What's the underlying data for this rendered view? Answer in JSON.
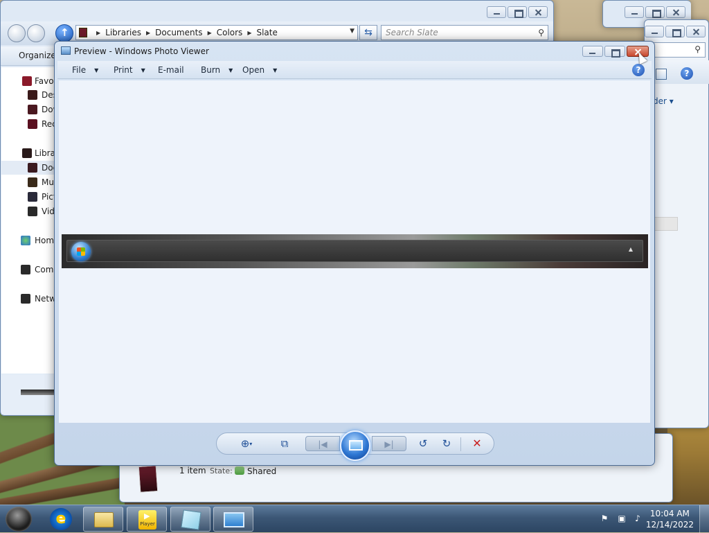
{
  "explorer": {
    "breadcrumb": [
      "Libraries",
      "Documents",
      "Colors",
      "Slate"
    ],
    "search_placeholder": "Search Slate",
    "organize_label": "Organize",
    "nav_items": [
      {
        "label": "Favorites",
        "group": "favorites"
      },
      {
        "label": "Desktop",
        "group": "favorites"
      },
      {
        "label": "Downloads",
        "group": "favorites"
      },
      {
        "label": "Recent Places",
        "group": "favorites"
      },
      {
        "label": "Libraries",
        "group": "libraries"
      },
      {
        "label": "Documents",
        "group": "libraries",
        "selected": true
      },
      {
        "label": "Music",
        "group": "libraries"
      },
      {
        "label": "Pictures",
        "group": "libraries"
      },
      {
        "label": "Videos",
        "group": "libraries"
      },
      {
        "label": "Homegroup",
        "group": "homegroup"
      },
      {
        "label": "Computer",
        "group": "computer"
      },
      {
        "label": "Network",
        "group": "network"
      }
    ],
    "details": {
      "count": "1 item",
      "state_label": "State:",
      "state_value": "Shared"
    },
    "arrange_label": "der ▾"
  },
  "photo_viewer": {
    "title": "Preview - Windows Photo Viewer",
    "menu": [
      {
        "label": "File",
        "has_arrow": true
      },
      {
        "label": "Print",
        "has_arrow": true
      },
      {
        "label": "E-mail",
        "has_arrow": false
      },
      {
        "label": "Burn",
        "has_arrow": true
      },
      {
        "label": "Open",
        "has_arrow": true
      }
    ],
    "controls": [
      "zoom-icon",
      "actual-size-icon",
      "previous-icon",
      "slideshow-icon",
      "next-icon",
      "rotate-counterclockwise-icon",
      "rotate-clockwise-icon",
      "delete-icon"
    ]
  },
  "taskbar": {
    "pinned": [
      "internet-explorer-icon",
      "windows-explorer-icon",
      "media-player-icon",
      "notepad-icon",
      "photo-viewer-icon"
    ],
    "player_label": "Player",
    "clock": {
      "time": "10:04 AM",
      "date": "12/14/2022"
    }
  },
  "colors": {
    "close_button": "#c9472d",
    "delete_x": "#c91e1e",
    "taskbar": "#3c5776"
  }
}
